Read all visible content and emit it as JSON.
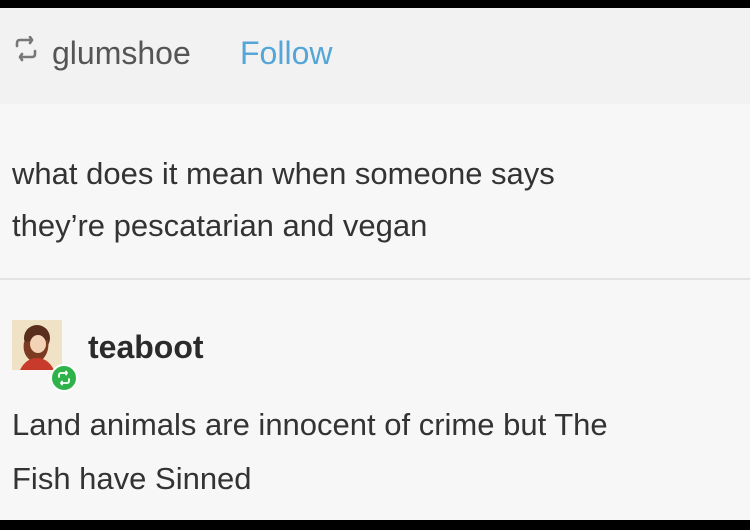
{
  "header": {
    "username": "glumshoe",
    "follow_label": "Follow"
  },
  "post": {
    "line1": "what does it mean when someone says",
    "line2": "they’re pescatarian and vegan"
  },
  "reply": {
    "username": "teaboot",
    "line1": "Land animals are innocent of crime but The",
    "line2": "Fish have Sinned"
  },
  "colors": {
    "follow": "#55a6d8",
    "badge": "#2fb24a",
    "text": "#333333"
  },
  "icons": {
    "reblog": "reblog-icon",
    "avatar_badge": "reblog-badge-icon"
  }
}
